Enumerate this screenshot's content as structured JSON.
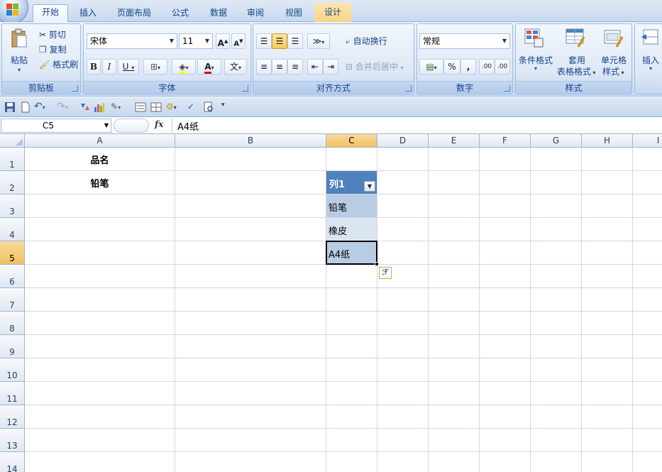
{
  "tabs": [
    "开始",
    "插入",
    "页面布局",
    "公式",
    "数据",
    "审阅",
    "视图",
    "设计"
  ],
  "ribbon": {
    "clipboard": {
      "paste": "粘贴",
      "cut": "剪切",
      "copy": "复制",
      "format_painter": "格式刷",
      "label": "剪贴板"
    },
    "font": {
      "name": "宋体",
      "size": "11",
      "grow": "A",
      "shrink": "A",
      "bold": "B",
      "italic": "I",
      "underline": "U",
      "font_color_letter": "A",
      "phonetic": "文",
      "label": "字体"
    },
    "alignment": {
      "wrap_text": "自动换行",
      "merge_center": "合并后居中",
      "label": "对齐方式"
    },
    "number": {
      "format": "常规",
      "percent": "%",
      "comma": ",",
      "inc_decimal": ".00",
      "dec_decimal": ".00",
      "label": "数字"
    },
    "styles": {
      "conditional": "条件格式",
      "table_format_1": "套用",
      "table_format_2": "表格格式",
      "cell_styles_1": "单元格",
      "cell_styles_2": "样式",
      "label": "样式"
    },
    "cells": {
      "insert": "插入"
    }
  },
  "formula_bar": {
    "name_box": "C5",
    "fx": "fx",
    "formula": "A4纸"
  },
  "columns": [
    "A",
    "B",
    "C",
    "D",
    "E",
    "F",
    "G",
    "H",
    "I"
  ],
  "rows": [
    "1",
    "2",
    "3",
    "4",
    "5",
    "6",
    "7",
    "8",
    "9",
    "10",
    "11",
    "12",
    "13",
    "14"
  ],
  "cells": {
    "A1": "品名",
    "A2": "铅笔",
    "C2": "列1",
    "C3": "铅笔",
    "C4": "橡皮",
    "C5": "A4纸"
  },
  "colors": {
    "table_header": "#4f81bd",
    "table_band_dark": "#b8cce4",
    "table_band_light": "#dbe5f1",
    "selected_header": "#f1c15f"
  }
}
